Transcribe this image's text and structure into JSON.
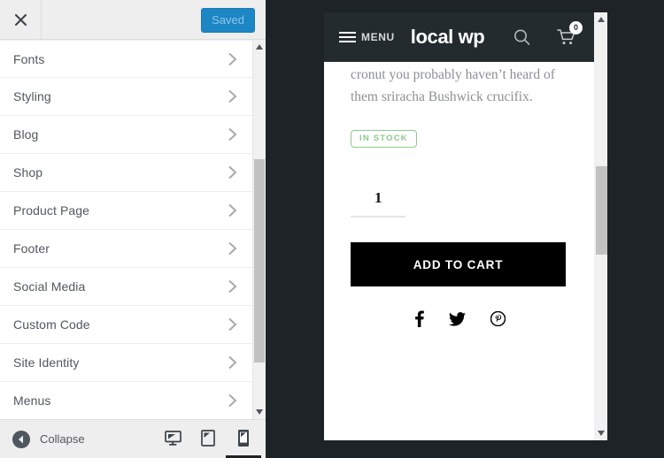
{
  "colors": {
    "accent_blue": "#1d86c4",
    "dark_chrome": "#1d2327",
    "site_header": "#232b2f",
    "stock_green": "#8fc98c",
    "button_black": "#000000"
  },
  "sidebar": {
    "header": {
      "close_icon": "close-icon",
      "save_label": "Saved"
    },
    "items": [
      {
        "label": "Fonts",
        "chevron": "chevron-right-icon"
      },
      {
        "label": "Styling",
        "chevron": "chevron-right-icon"
      },
      {
        "label": "Blog",
        "chevron": "chevron-right-icon"
      },
      {
        "label": "Shop",
        "chevron": "chevron-right-icon"
      },
      {
        "label": "Product Page",
        "chevron": "chevron-right-icon"
      },
      {
        "label": "Footer",
        "chevron": "chevron-right-icon"
      },
      {
        "label": "Social Media",
        "chevron": "chevron-right-icon"
      },
      {
        "label": "Custom Code",
        "chevron": "chevron-right-icon"
      },
      {
        "label": "Site Identity",
        "chevron": "chevron-right-icon"
      },
      {
        "label": "Menus",
        "chevron": "chevron-right-icon"
      }
    ],
    "footer": {
      "collapse_label": "Collapse",
      "collapse_icon": "collapse-arrow-icon",
      "devices": [
        {
          "name": "desktop",
          "icon": "desktop-icon",
          "active": false
        },
        {
          "name": "tablet",
          "icon": "tablet-icon",
          "active": false
        },
        {
          "name": "mobile",
          "icon": "mobile-icon",
          "active": true
        }
      ]
    }
  },
  "preview": {
    "site_header": {
      "menu_label": "MENU",
      "menu_icon": "hamburger-icon",
      "logo_text": "local wp",
      "search_icon": "search-icon",
      "cart_icon": "cart-icon",
      "cart_count": "0"
    },
    "product": {
      "description": "cronut you probably haven’t heard of them sriracha Bushwick crucifix.",
      "stock_status": "IN STOCK",
      "quantity_value": "1",
      "add_to_cart_label": "ADD TO CART",
      "social": [
        {
          "name": "facebook",
          "icon": "facebook-icon"
        },
        {
          "name": "twitter",
          "icon": "twitter-icon"
        },
        {
          "name": "pinterest",
          "icon": "pinterest-icon"
        }
      ]
    }
  }
}
